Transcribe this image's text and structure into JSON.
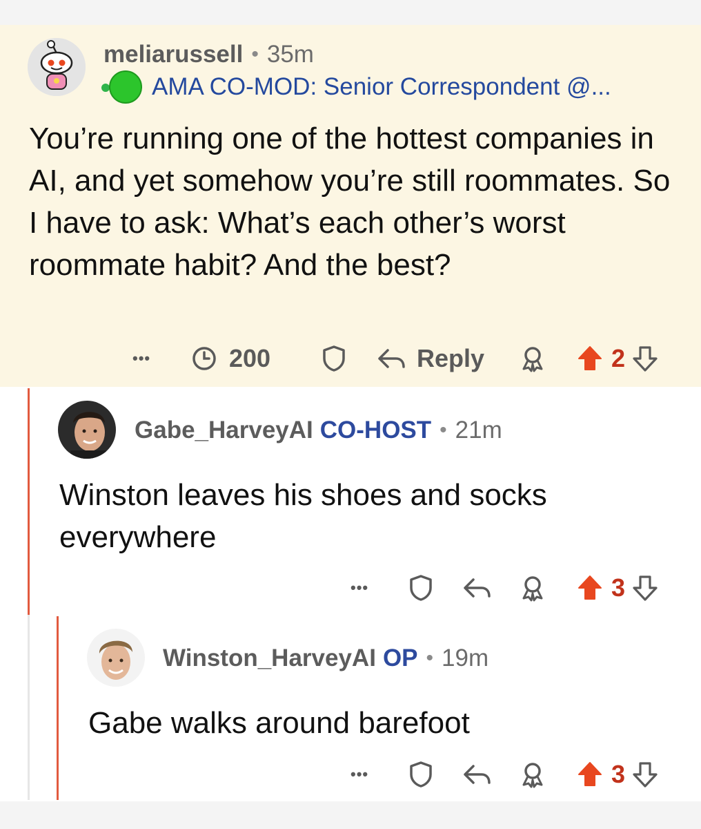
{
  "post": {
    "username": "meliarussell",
    "time": "35m",
    "flair": "AMA CO-MOD: Senior Correspondent @...",
    "body": "You’re running one of the hottest companies in AI, and yet somehow you’re still roommates. So I have to ask: What’s each other’s worst roommate habit? And the best?",
    "views": "200",
    "reply_label": "Reply",
    "votes": "2"
  },
  "reply1": {
    "username": "Gabe_HarveyAI",
    "tag": "CO-HOST",
    "time": "21m",
    "body": "Winston leaves his shoes and socks everywhere",
    "votes": "3"
  },
  "reply2": {
    "username": "Winston_HarveyAI",
    "tag": "OP",
    "time": "19m",
    "body": "Gabe walks around barefoot",
    "votes": "3"
  },
  "meta": {
    "separator": "•",
    "more": "•••"
  },
  "colors": {
    "upvote": "#e8471f",
    "highlight": "#fcf6e3",
    "thread": "#e25a3f",
    "flair": "#24499e"
  },
  "icons": [
    "snoo-avatar-icon",
    "online-dot-icon",
    "views-icon",
    "shield-icon",
    "reply-arrow-icon",
    "award-icon",
    "upvote-icon",
    "downvote-icon",
    "more-icon"
  ]
}
